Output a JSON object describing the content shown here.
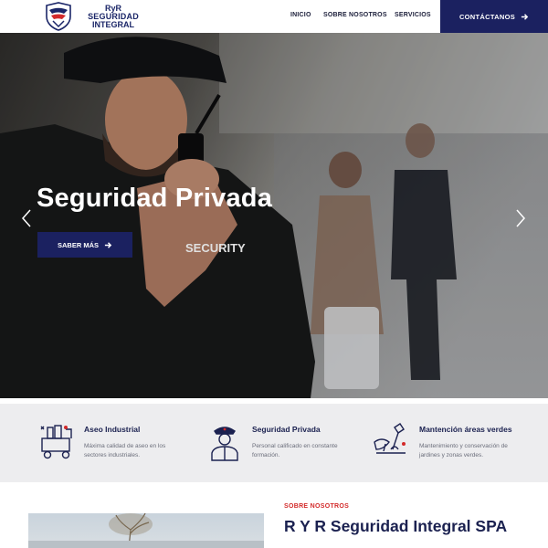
{
  "header": {
    "logo": {
      "line1": "RyR",
      "line2": "SEGURIDAD",
      "line3": "INTEGRAL"
    },
    "nav": [
      {
        "label": "INICIO"
      },
      {
        "label": "SOBRE NOSOTROS"
      },
      {
        "label": "SERVICIOS"
      }
    ],
    "cta_label": "CONTÁCTANOS"
  },
  "hero": {
    "title": "Seguridad Privada",
    "button_label": "SABER MÁS",
    "shirt_text": "SECURITY"
  },
  "services": [
    {
      "title": "Aseo Industrial",
      "description": "Máxima calidad de aseo en los sectores industriales.",
      "icon": "cleaning-cart-icon"
    },
    {
      "title": "Seguridad Privada",
      "description": "Personal calificado en constante formación.",
      "icon": "security-guard-icon"
    },
    {
      "title": "Mantención áreas verdes",
      "description": "Mantenimiento y conservación de jardines y zonas verdes.",
      "icon": "gardening-icon"
    }
  ],
  "about": {
    "label": "SOBRE NOSOTROS",
    "title": "R Y R Seguridad Integral SPA"
  },
  "colors": {
    "brand_navy": "#1b2160",
    "accent_red": "#d32a2a",
    "band_gray": "#ededef"
  }
}
